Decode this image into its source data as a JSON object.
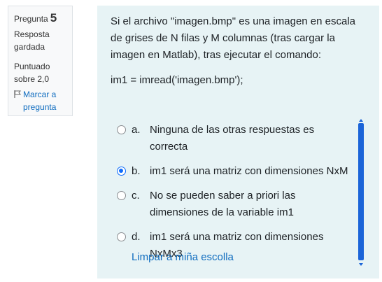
{
  "info": {
    "question_label": "Pregunta",
    "question_number": "5",
    "state": "Resposta gardada",
    "grade": "Puntuado sobre 2,0",
    "flag_label": "Marcar a pregunta"
  },
  "question": {
    "text_p1": "Si el archivo \"imagen.bmp\" es una imagen en escala de grises de N filas y M columnas (tras cargar la imagen en Matlab), tras ejecutar el comando:",
    "text_p2": "im1 = imread('imagen.bmp');"
  },
  "answers": [
    {
      "letter": "a.",
      "text": "Ninguna de las otras respuestas es correcta",
      "selected": false
    },
    {
      "letter": "b.",
      "text": "im1 será una matriz con dimensiones NxM",
      "selected": true
    },
    {
      "letter": "c.",
      "text": "No se pueden saber a priori las dimensiones de la variable im1",
      "selected": false
    },
    {
      "letter": "d.",
      "text": "im1 será una matriz con dimensiones NxMx3",
      "selected": false
    }
  ],
  "clear_label": "Limpar a miña escolla",
  "colors": {
    "accent": "#0f6cbf",
    "panel_bg": "#e7f3f5",
    "info_bg": "#f8f9fa"
  }
}
